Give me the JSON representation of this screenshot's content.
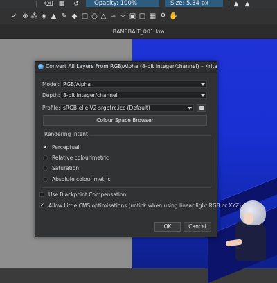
{
  "toolbar": {
    "opacity_label": "Opacity: 100%",
    "size_label": "Size: 5.34 px",
    "icons": [
      "eraser-icon",
      "checker-icon",
      "reset-icon",
      "mirror-h-icon",
      "mirror-v-icon"
    ]
  },
  "tools": [
    "brush",
    "transform",
    "rect-select",
    "ellipse-select",
    "polygon-select",
    "freehand-select",
    "contiguous-select",
    "similar-select",
    "bezier-select",
    "magnetic-select",
    "zoom",
    "pan"
  ],
  "document": {
    "title": "BANEBAIT_001.kra"
  },
  "dialog": {
    "title": "Convert All Layers From RGB/Alpha (8-bit integer/channel) – Krita",
    "model_label": "Model:",
    "model_value": "RGB/Alpha",
    "depth_label": "Depth:",
    "depth_value": "8-bit integer/channel",
    "profile_label": "Profile:",
    "profile_value": "sRGB-elle-V2-srgbtrc.icc (Default)",
    "browser_button": "Colour Space Browser",
    "rendering_intent_title": "Rendering Intent",
    "intents": [
      {
        "label": "Perceptual",
        "selected": true
      },
      {
        "label": "Relative colourimetric",
        "selected": false
      },
      {
        "label": "Saturation",
        "selected": false
      },
      {
        "label": "Absolute colourimetric",
        "selected": false
      }
    ],
    "blackpoint_label": "Use Blackpoint Compensation",
    "blackpoint_checked": false,
    "lcms_label": "Allow Little CMS optimisations (untick when using linear light RGB or XYZ)",
    "lcms_checked": true,
    "ok_label": "OK",
    "cancel_label": "Cancel"
  }
}
